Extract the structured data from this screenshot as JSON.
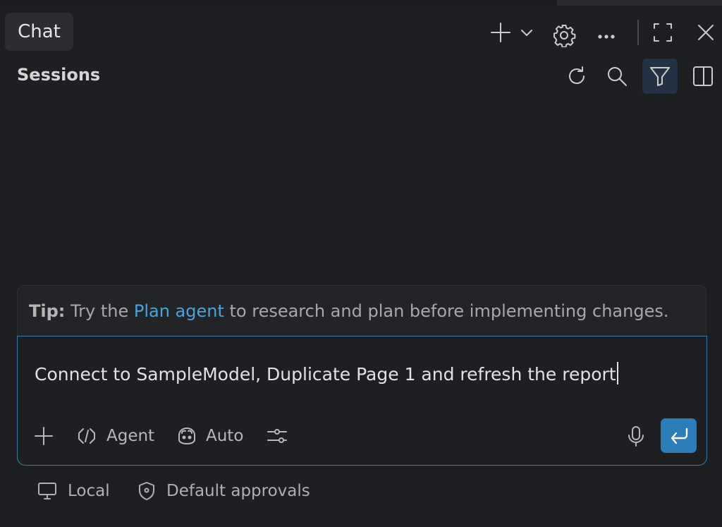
{
  "header": {
    "tab_label": "Chat",
    "icons": [
      "plus-icon",
      "chevron-down-icon",
      "gear-icon",
      "more-icon",
      "maximize-icon",
      "close-icon"
    ]
  },
  "sessions": {
    "title": "Sessions",
    "icons": [
      "refresh-icon",
      "search-icon",
      "filter-icon",
      "split-panel-icon"
    ]
  },
  "tip": {
    "label": "Tip:",
    "prefix": " Try the ",
    "link": "Plan agent",
    "suffix": " to research and plan before implementing changes."
  },
  "input": {
    "value": "Connect to SampleModel, Duplicate Page 1 and refresh the report"
  },
  "toolbar": {
    "agent_label": "Agent",
    "model_label": "Auto"
  },
  "footer": {
    "local_label": "Local",
    "approvals_label": "Default approvals"
  },
  "colors": {
    "background": "#1e1f22",
    "accent": "#2d7eb8",
    "link": "#4da3d6",
    "input_border": "#3a7ea8",
    "filter_active_bg": "#233244"
  }
}
